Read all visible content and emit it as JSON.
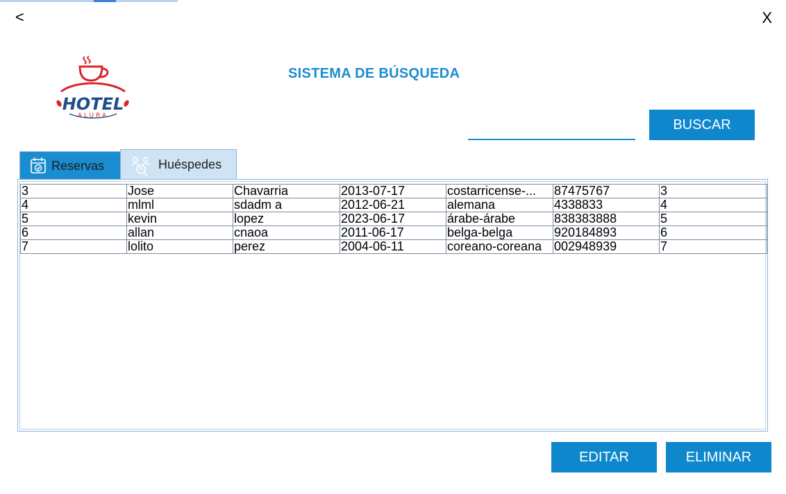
{
  "window": {
    "back_label": "<",
    "close_label": "X"
  },
  "logo": {
    "text_main": "HOTEL",
    "text_sub": "ALURA",
    "icon": "coffee-cup-logo"
  },
  "header": {
    "title": "SISTEMA DE BÚSQUEDA"
  },
  "search": {
    "value": "",
    "button_label": "BUSCAR"
  },
  "tabs": [
    {
      "label": "Reservas",
      "icon": "calendar-icon",
      "selected": false
    },
    {
      "label": "Huéspedes",
      "icon": "users-search-icon",
      "selected": true
    }
  ],
  "table": {
    "rows": [
      [
        "3",
        "Jose",
        "Chavarria",
        "2013-07-17",
        "costarricense-...",
        "87475767",
        "3"
      ],
      [
        "4",
        "mlml",
        "sdadm a",
        "2012-06-21",
        "alemana",
        "4338833",
        "4"
      ],
      [
        "5",
        "kevin",
        "lopez",
        "2023-06-17",
        "árabe-árabe",
        "838383888",
        "5"
      ],
      [
        "6",
        "allan",
        "cnaoa",
        "2011-06-17",
        "belga-belga",
        "920184893",
        "6"
      ],
      [
        "7",
        "lolito",
        "perez",
        "2004-06-11",
        "coreano-coreana",
        "002948939",
        "7"
      ]
    ]
  },
  "actions": {
    "edit_label": "EDITAR",
    "delete_label": "ELIMINAR"
  },
  "colors": {
    "accent": "#0f87cc",
    "title": "#1a8cd0",
    "logo_red": "#d8262c",
    "logo_blue": "#1f4c8c"
  }
}
